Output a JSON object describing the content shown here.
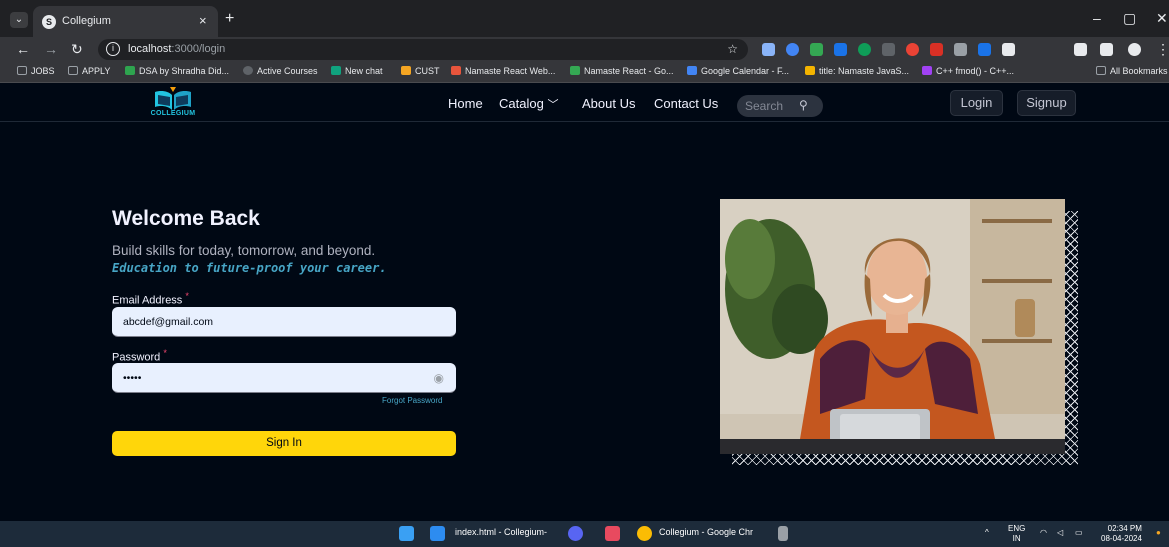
{
  "browser": {
    "tab_title": "Collegium",
    "tab_close": "×",
    "new_tab": "+",
    "url_host": "localhost",
    "url_path": ":3000/login",
    "window_buttons": [
      "–",
      "▢",
      "✕"
    ],
    "nav_icons": [
      "back-arrow-icon",
      "forward-arrow-icon",
      "reload-icon",
      "info-icon"
    ]
  },
  "bookmarks": [
    {
      "label": "JOBS",
      "color": "#9aa0a6"
    },
    {
      "label": "APPLY",
      "color": "#9aa0a6"
    },
    {
      "label": "DSA by Shradha Did...",
      "color": "#2ea44f"
    },
    {
      "label": "Active Courses",
      "color": "#5f6368"
    },
    {
      "label": "New chat",
      "color": "#10a37f"
    },
    {
      "label": "CUST",
      "color": "#f5a623"
    },
    {
      "label": "Namaste React Web...",
      "color": "#e8553c"
    },
    {
      "label": "Namaste React - Go...",
      "color": "#34a853"
    },
    {
      "label": "Google Calendar - F...",
      "color": "#4285f4"
    },
    {
      "label": "title: Namaste JavaS...",
      "color": "#f4b400"
    },
    {
      "label": "C++ fmod() - C++...",
      "color": "#a142f4"
    },
    {
      "label": "All Bookmarks",
      "color": "#9aa0a6"
    }
  ],
  "site": {
    "logo_text": "COLLEGIUM",
    "nav": {
      "home": "Home",
      "catalog": "Catalog",
      "about": "About Us",
      "contact": "Contact Us",
      "search_placeholder": "Search",
      "login": "Login",
      "signup": "Signup"
    }
  },
  "login": {
    "heading": "Welcome Back",
    "subtitle": "Build skills for today, tomorrow, and beyond.",
    "tagline": "Education to future-proof your career.",
    "email_label": "Email Address",
    "email_value": "abcdef@gmail.com",
    "password_label": "Password",
    "password_value": "•••••",
    "required_mark": "*",
    "forgot": "Forgot Password",
    "submit": "Sign In"
  },
  "taskbar": {
    "vscode_label": "index.html - Collegium-",
    "chrome_label": "Collegium - Google Chr",
    "lang_top": "ENG",
    "lang_bottom": "IN",
    "time": "02:34 PM",
    "date": "08-04-2024"
  },
  "colors": {
    "page_bg": "#000814",
    "accent_yellow": "#ffd60a",
    "link_blue": "#47a5c5",
    "required_red": "#ef476f"
  }
}
